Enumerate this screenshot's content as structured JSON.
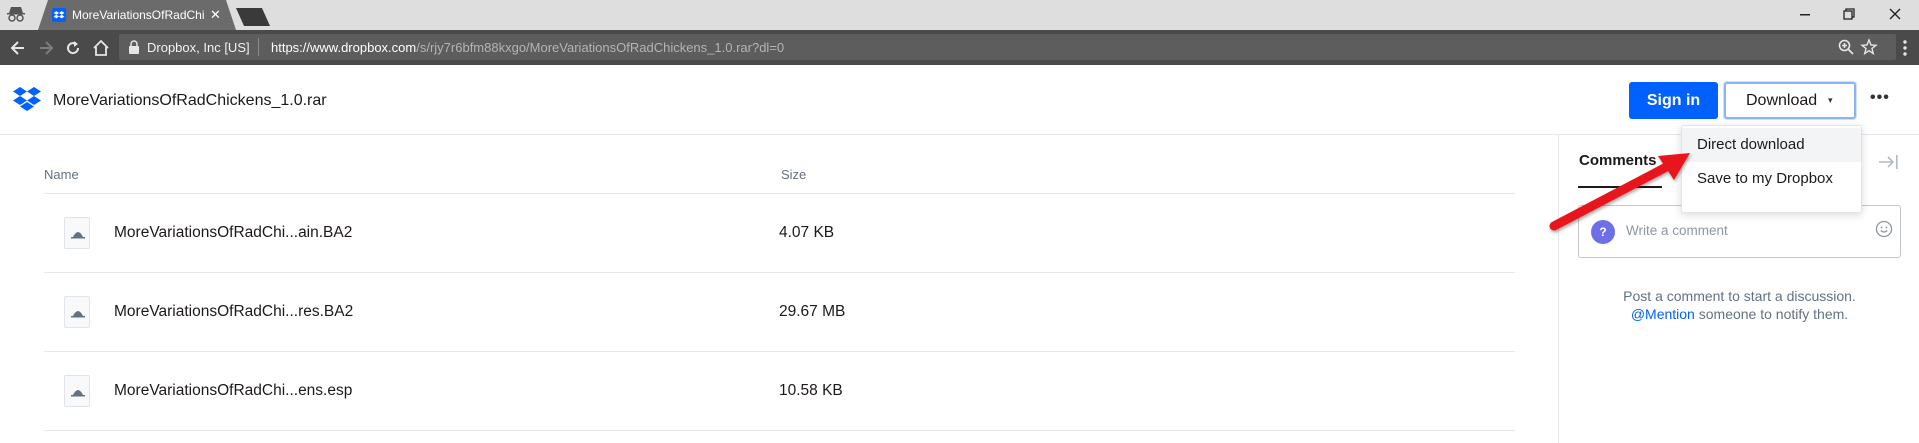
{
  "browser": {
    "tab_title": "MoreVariationsOfRadChickens_1.0.rar",
    "site_identity": "Dropbox, Inc [US]",
    "url_host": "https://www.dropbox.com",
    "url_path": "/s/rjy7r6bfm88kxgo/MoreVariationsOfRadChickens_1.0.rar?dl=0"
  },
  "header": {
    "filename": "MoreVariationsOfRadChickens_1.0.rar",
    "signin_label": "Sign in",
    "download_label": "Download",
    "caret": "▾",
    "more": "•••"
  },
  "table": {
    "col_name": "Name",
    "col_size": "Size",
    "rows": [
      {
        "name": "MoreVariationsOfRadChi...ain.BA2",
        "size": "4.07 KB"
      },
      {
        "name": "MoreVariationsOfRadChi...res.BA2",
        "size": "29.67 MB"
      },
      {
        "name": "MoreVariationsOfRadChi...ens.esp",
        "size": "10.58 KB"
      }
    ]
  },
  "comments": {
    "tab_label": "Comments",
    "avatar_glyph": "?",
    "placeholder": "Write a comment",
    "hint_line1": "Post a comment to start a discussion.",
    "mention": "@Mention",
    "hint_line2_rest": " someone to notify them."
  },
  "dropdown": {
    "items": [
      "Direct download",
      "Save to my Dropbox"
    ]
  },
  "colors": {
    "brand_blue": "#0061fe",
    "annotation_arrow": "#e8141a"
  }
}
